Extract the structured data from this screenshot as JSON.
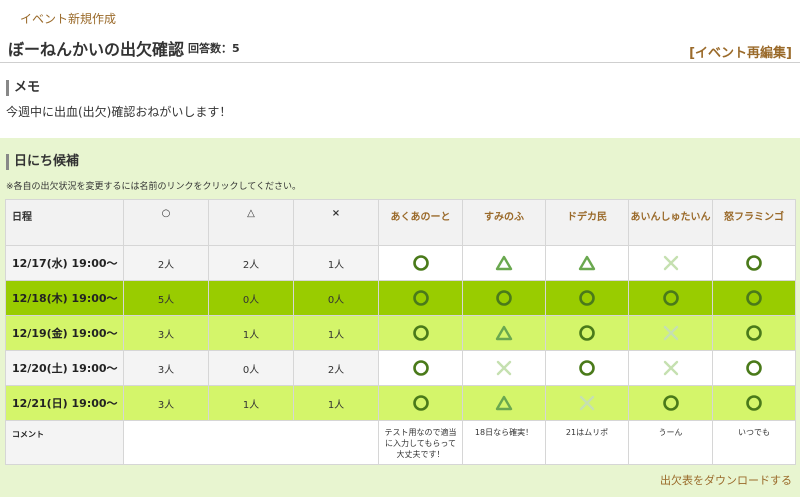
{
  "header": {
    "new_event_link": "イベント新規作成",
    "title": "ぼーねんかいの出欠確認",
    "answer_count": "回答数：5",
    "edit_link": "[イベント再編集]"
  },
  "memo": {
    "heading": "メモ",
    "text": "今週中に出血(出欠)確認おねがいします！"
  },
  "candidates": {
    "heading": "日にち候補",
    "note": "※各自の出欠状況を変更するには名前のリンクをクリックしてください。",
    "columns": {
      "date": "日程",
      "ok": "○",
      "maybe": "△",
      "ng": "×"
    },
    "members": [
      "あくあのーと",
      "すみのふ",
      "ドデカ民",
      "あいんしゅたいん",
      "怒フラミンゴ"
    ],
    "rows": [
      {
        "date": "12/17(水) 19:00〜",
        "ok": "2人",
        "maybe": "2人",
        "ng": "1人",
        "style": "white",
        "answers": [
          "o",
          "t",
          "t",
          "x",
          "o"
        ]
      },
      {
        "date": "12/18(木) 19:00〜",
        "ok": "5人",
        "maybe": "0人",
        "ng": "0人",
        "style": "dark",
        "answers": [
          "o",
          "o",
          "o",
          "o",
          "o"
        ]
      },
      {
        "date": "12/19(金) 19:00〜",
        "ok": "3人",
        "maybe": "1人",
        "ng": "1人",
        "style": "light",
        "answers": [
          "o",
          "t",
          "o",
          "x",
          "o"
        ]
      },
      {
        "date": "12/20(土) 19:00〜",
        "ok": "3人",
        "maybe": "0人",
        "ng": "2人",
        "style": "white",
        "answers": [
          "o",
          "x",
          "o",
          "x",
          "o"
        ]
      },
      {
        "date": "12/21(日) 19:00〜",
        "ok": "3人",
        "maybe": "1人",
        "ng": "1人",
        "style": "light",
        "answers": [
          "o",
          "t",
          "x",
          "o",
          "o"
        ]
      }
    ],
    "comment_label": "コメント",
    "comments": [
      "テスト用なので適当に入力してもらって大丈夫です！",
      "18日なら確実！",
      "21はムリポ",
      "うーん",
      "いつでも"
    ]
  },
  "download_link": "出欠表をダウンロードする",
  "colors": {
    "link": "#9a6a2a",
    "row_dark": "#99cc00",
    "row_light": "#d4f56a",
    "section_bg": "#e8f5d0",
    "symbol_ok": "#4a7a1a",
    "symbol_maybe": "#6aa84f",
    "symbol_ng": "#c5e0b0"
  },
  "icons": {
    "o": "circle-ok-icon",
    "t": "triangle-maybe-icon",
    "x": "cross-ng-icon"
  }
}
